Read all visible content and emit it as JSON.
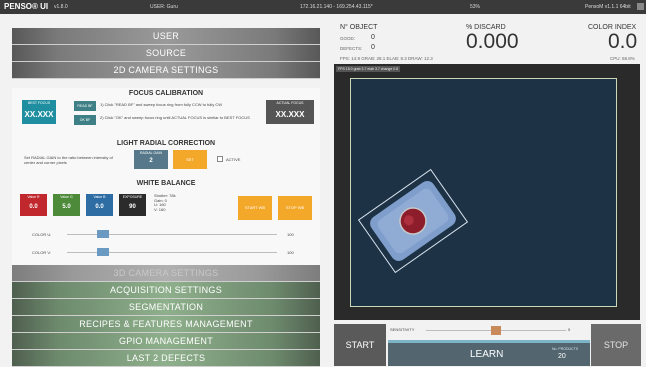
{
  "topbar": {
    "brand": "PENSO® UI",
    "version": "v1.8.0",
    "user": "USER: Guru",
    "ip": "172.16.21.140 - 169.254.43.115*",
    "percent": "53%",
    "right_info": "PensoM v1.1.1 64bit"
  },
  "left_menu": {
    "user": "USER",
    "source": "SOURCE",
    "camera_2d": "2D CAMERA SETTINGS",
    "camera_3d": "3D CAMERA SETTINGS",
    "acquisition": "ACQUISITION SETTINGS",
    "segmentation": "SEGMENTATION",
    "recipes": "RECIPES & FEATURES MANAGEMENT",
    "gpio": "GPIO MANAGEMENT",
    "last_defects": "LAST 2 DEFECTS"
  },
  "focus": {
    "title": "FOCUS CALIBRATION",
    "best_label": "BEST FOCUS",
    "best_value": "XX.XXX",
    "actual_label": "ACTUAL FOCUS",
    "actual_value": "XX.XXX",
    "read_btn": "READ BF",
    "ok_btn": "OK BF",
    "step1": "1) Click \"READ BF\" and sweep focus ring from fully CCW to fully CW",
    "step2": "2) Click \"OK\" and sweep focus ring until ACTUAL FOCUS is similar to BEST FOCUS"
  },
  "radial": {
    "title": "LIGHT RADIAL CORRECTION",
    "note": "Set RADIAL GAIN to the ratio between intensity of center and corner pixels",
    "gain_label": "RADIAL GAIN",
    "gain_value": "2",
    "set_btn": "SET",
    "active_label": "ACTIVE"
  },
  "white_balance": {
    "title": "WHITE BALANCE",
    "tiles": [
      {
        "label": "Value R",
        "value": "0.0",
        "color": "#c0282d"
      },
      {
        "label": "Value G",
        "value": "5.0",
        "color": "#4d8a3a"
      },
      {
        "label": "Value B",
        "value": "0.0",
        "color": "#2e6da4"
      },
      {
        "label": "EXPOSURE",
        "value": "90",
        "color": "#2b2b2b"
      }
    ],
    "info": [
      "Shutter: 78k",
      "Gain: 0",
      "U: 160",
      "V: 160"
    ],
    "start_btn": "START WB",
    "stop_btn": "STOP WB",
    "color_u_label": "COLOR U:",
    "color_u_value": "100",
    "color_v_label": "COLOR V:",
    "color_v_value": "100",
    "color_u_level": 0.17,
    "color_v_level": 0.17
  },
  "stats": {
    "object_label": "N° OBJECT",
    "good_label": "GOOD:",
    "good_value": "0",
    "defects_label": "DEFECTS:",
    "defects_value": "0",
    "discard_label": "% DISCARD",
    "discard_value": "0.000",
    "color_index_label": "COLOR INDEX",
    "color_index_value": "0.0",
    "fps_line": "FPS: 14.9   GRAB: 28.1   ELAB: 8.3   DRAW: 12.3",
    "cpu": "CPU: 58.8%"
  },
  "camera": {
    "overlay_tag": "FPS 15.0  grab 3.7  elab 3.7  change 0.8"
  },
  "controls": {
    "start": "START",
    "stop": "STOP",
    "sensitivity_label": "SENSITIVITY",
    "sensitivity_value": "5",
    "sensitivity_level": 0.5,
    "learn": "LEARN",
    "products_label": "No. PRODUCTS",
    "products_value": "20"
  },
  "colors": {
    "accent_teal": "#3f7f86",
    "orange": "#f4a82a",
    "focus_tile": "#1f8ea0",
    "actual_tile": "#555555",
    "gain_tile": "#56788a"
  }
}
